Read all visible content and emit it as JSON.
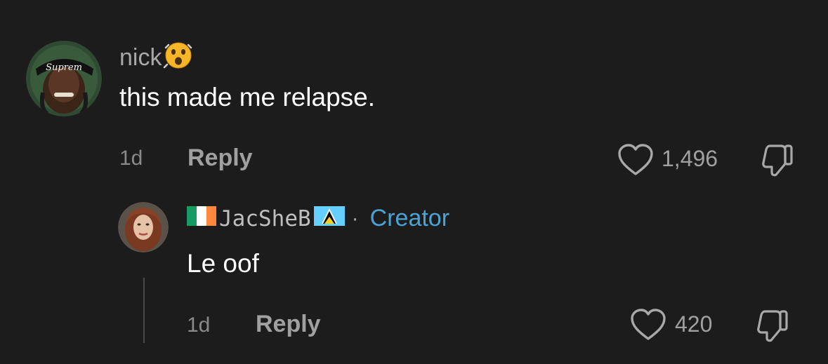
{
  "comment": {
    "username": "nick",
    "text": "this made me relapse.",
    "time": "1d",
    "reply_label": "Reply",
    "likes": "1,496",
    "avatar_text": "Suprem"
  },
  "reply": {
    "username": "JacSheB",
    "separator": "·",
    "creator_label": "Creator",
    "text": "Le oof",
    "time": "1d",
    "reply_label": "Reply",
    "likes": "420"
  },
  "colors": {
    "background": "#1c1c1c",
    "creator": "#4aa3d6",
    "muted": "#a0a0a0"
  }
}
